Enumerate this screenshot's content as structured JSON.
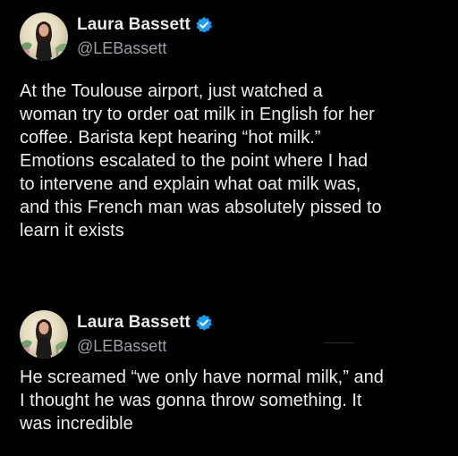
{
  "tweets": [
    {
      "author": {
        "name": "Laura Bassett",
        "handle": "@LEBassett",
        "verified": true
      },
      "text": "At the Toulouse airport, just watched a\nwoman try to order oat milk in English for her\ncoffee. Barista kept hearing “hot milk.”\nEmotions escalated to the point where I had\nto intervene and explain what oat milk was,\nand this French man was absolutely pissed to\nlearn it exists"
    },
    {
      "author": {
        "name": "Laura Bassett",
        "handle": "@LEBassett",
        "verified": true
      },
      "text": "He screamed “we only have normal milk,” and\nI thought he was gonna throw something. It\nwas incredible"
    }
  ],
  "colors": {
    "background": "#000000",
    "text": "#e7e9ea",
    "handle": "#9aa0a6",
    "verified_badge": "#1d9bf0"
  },
  "icons": {
    "verified": "verified-badge-icon",
    "avatar": "profile-photo"
  }
}
